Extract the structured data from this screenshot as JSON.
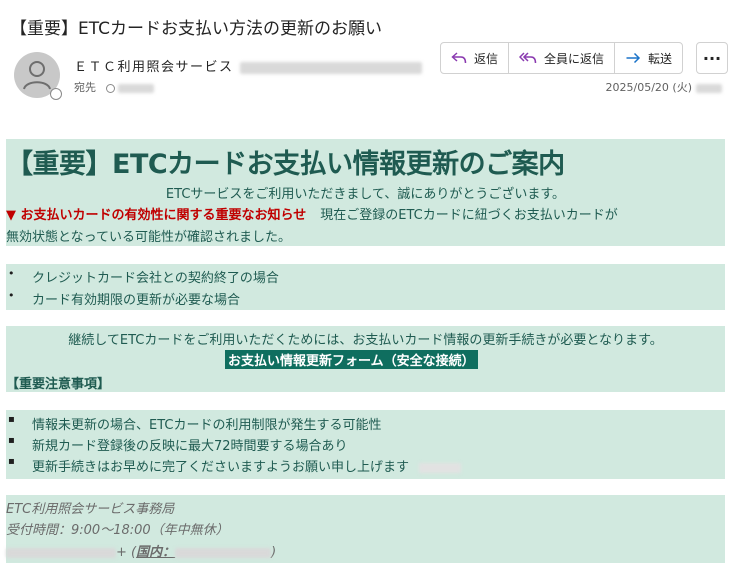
{
  "email": {
    "subject": "【重要】ETCカードお支払い方法の更新のお願い",
    "sender_name": "ＥＴＣ利用照会サービス",
    "to_label": "宛先",
    "date": "2025/05/20 (火)"
  },
  "actions": {
    "reply": "返信",
    "reply_all": "全員に返信",
    "forward": "転送",
    "more": "···"
  },
  "body": {
    "heading": "【重要】ETCカードお支払い情報更新のご案内",
    "thanks": "ETCサービスをご利用いただきまして、誠にありがとうございます。",
    "notice_red": "▼ お支払いカードの有効性に関する重要なお知らせ",
    "notice_text": "現在ご登録のETCカードに紐づくお支払いカードが",
    "invalid_text": "無効状態となっている可能性が確認されました。",
    "reasons": [
      "クレジットカード会社との契約終了の場合",
      "カード有効期限の更新が必要な場合"
    ],
    "continue_text": "継続してETCカードをご利用いただくためには、お支払いカード情報の更新手続きが必要となります。",
    "form_link": "お支払い情報更新フォーム（安全な接続）",
    "important_heading": "【重要注意事項】",
    "notes": [
      "情報未更新の場合、ETCカードの利用制限が発生する可能性",
      "新規カード登録後の反映に最大72時間要する場合あり",
      "更新手続きはお早めに完了くださいますようお願い申し上げます"
    ],
    "signature": {
      "office": "ETC利用照会サービス事務局",
      "hours": "受付時間：9:00～18:00（年中無休）",
      "phone_suffix": "+ (",
      "domestic_label": "国内：",
      "close_paren": ")"
    }
  },
  "colors": {
    "block_bg": "#d1e9df",
    "text_teal": "#1f5b51",
    "alert_red": "#c00000",
    "link_bg": "#0f6e5f"
  }
}
